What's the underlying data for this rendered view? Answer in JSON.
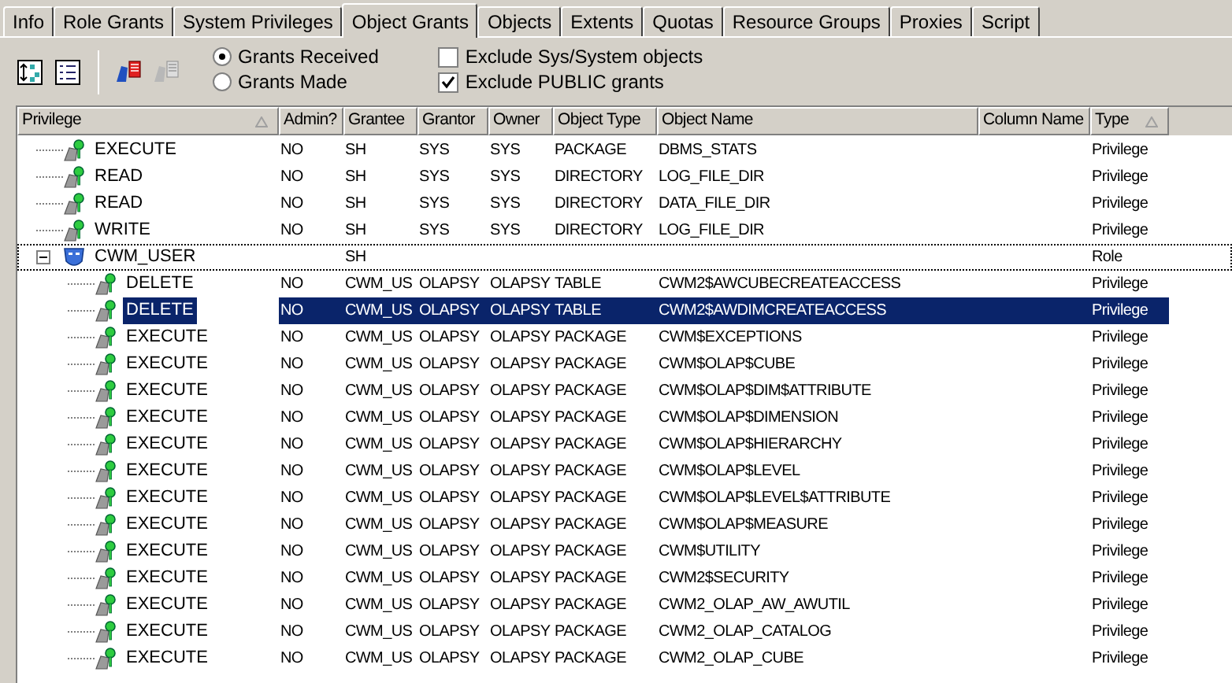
{
  "tabs": [
    {
      "label": "Info",
      "selected": false
    },
    {
      "label": "Role Grants",
      "selected": false
    },
    {
      "label": "System Privileges",
      "selected": false
    },
    {
      "label": "Object Grants",
      "selected": true
    },
    {
      "label": "Objects",
      "selected": false
    },
    {
      "label": "Extents",
      "selected": false
    },
    {
      "label": "Quotas",
      "selected": false
    },
    {
      "label": "Resource Groups",
      "selected": false
    },
    {
      "label": "Proxies",
      "selected": false
    },
    {
      "label": "Script",
      "selected": false
    }
  ],
  "toolbar": [
    {
      "kind": "tree",
      "disabled": false
    },
    {
      "kind": "list",
      "disabled": false
    },
    {
      "kind": "grant",
      "disabled": false
    },
    {
      "kind": "revoke",
      "disabled": true
    }
  ],
  "radios": [
    {
      "label": "Grants Received",
      "selected": true
    },
    {
      "label": "Grants Made",
      "selected": false
    }
  ],
  "checkboxes": [
    {
      "label": "Exclude Sys/System objects",
      "checked": false
    },
    {
      "label": "Exclude PUBLIC grants",
      "checked": true
    }
  ],
  "table": {
    "columns": [
      {
        "label": "Privilege",
        "sort": true
      },
      {
        "label": "Admin?",
        "sort": false
      },
      {
        "label": "Grantee",
        "sort": false
      },
      {
        "label": "Grantor",
        "sort": false
      },
      {
        "label": "Owner",
        "sort": false
      },
      {
        "label": "Object Type",
        "sort": false
      },
      {
        "label": "Object Name",
        "sort": false
      },
      {
        "label": "Column Name",
        "sort": false
      },
      {
        "label": "Type",
        "sort": true
      }
    ],
    "rows": [
      {
        "kind": "privilege",
        "selected": false,
        "cells": [
          "EXECUTE",
          "NO",
          "SH",
          "SYS",
          "SYS",
          "PACKAGE",
          "DBMS_STATS",
          "",
          "Privilege"
        ]
      },
      {
        "kind": "privilege",
        "selected": false,
        "cells": [
          "READ",
          "NO",
          "SH",
          "SYS",
          "SYS",
          "DIRECTORY",
          "LOG_FILE_DIR",
          "",
          "Privilege"
        ]
      },
      {
        "kind": "privilege",
        "selected": false,
        "cells": [
          "READ",
          "NO",
          "SH",
          "SYS",
          "SYS",
          "DIRECTORY",
          "DATA_FILE_DIR",
          "",
          "Privilege"
        ]
      },
      {
        "kind": "privilege",
        "selected": false,
        "cells": [
          "WRITE",
          "NO",
          "SH",
          "SYS",
          "SYS",
          "DIRECTORY",
          "LOG_FILE_DIR",
          "",
          "Privilege"
        ]
      },
      {
        "kind": "role",
        "selected": false,
        "expanded": true,
        "cells": [
          "CWM_USER",
          "",
          "SH",
          "",
          "",
          "",
          "",
          "",
          "Role"
        ],
        "children": [
          {
            "kind": "privilege",
            "selected": false,
            "cells": [
              "DELETE",
              "NO",
              "CWM_US",
              "OLAPSY",
              "OLAPSY",
              "TABLE",
              "CWM2$AWCUBECREATEACCESS",
              "",
              "Privilege"
            ]
          },
          {
            "kind": "privilege",
            "selected": true,
            "cells": [
              "DELETE",
              "NO",
              "CWM_US",
              "OLAPSY",
              "OLAPSY",
              "TABLE",
              "CWM2$AWDIMCREATEACCESS",
              "",
              "Privilege"
            ]
          },
          {
            "kind": "privilege",
            "selected": false,
            "cells": [
              "EXECUTE",
              "NO",
              "CWM_US",
              "OLAPSY",
              "OLAPSY",
              "PACKAGE",
              "CWM$EXCEPTIONS",
              "",
              "Privilege"
            ]
          },
          {
            "kind": "privilege",
            "selected": false,
            "cells": [
              "EXECUTE",
              "NO",
              "CWM_US",
              "OLAPSY",
              "OLAPSY",
              "PACKAGE",
              "CWM$OLAP$CUBE",
              "",
              "Privilege"
            ]
          },
          {
            "kind": "privilege",
            "selected": false,
            "cells": [
              "EXECUTE",
              "NO",
              "CWM_US",
              "OLAPSY",
              "OLAPSY",
              "PACKAGE",
              "CWM$OLAP$DIM$ATTRIBUTE",
              "",
              "Privilege"
            ]
          },
          {
            "kind": "privilege",
            "selected": false,
            "cells": [
              "EXECUTE",
              "NO",
              "CWM_US",
              "OLAPSY",
              "OLAPSY",
              "PACKAGE",
              "CWM$OLAP$DIMENSION",
              "",
              "Privilege"
            ]
          },
          {
            "kind": "privilege",
            "selected": false,
            "cells": [
              "EXECUTE",
              "NO",
              "CWM_US",
              "OLAPSY",
              "OLAPSY",
              "PACKAGE",
              "CWM$OLAP$HIERARCHY",
              "",
              "Privilege"
            ]
          },
          {
            "kind": "privilege",
            "selected": false,
            "cells": [
              "EXECUTE",
              "NO",
              "CWM_US",
              "OLAPSY",
              "OLAPSY",
              "PACKAGE",
              "CWM$OLAP$LEVEL",
              "",
              "Privilege"
            ]
          },
          {
            "kind": "privilege",
            "selected": false,
            "cells": [
              "EXECUTE",
              "NO",
              "CWM_US",
              "OLAPSY",
              "OLAPSY",
              "PACKAGE",
              "CWM$OLAP$LEVEL$ATTRIBUTE",
              "",
              "Privilege"
            ]
          },
          {
            "kind": "privilege",
            "selected": false,
            "cells": [
              "EXECUTE",
              "NO",
              "CWM_US",
              "OLAPSY",
              "OLAPSY",
              "PACKAGE",
              "CWM$OLAP$MEASURE",
              "",
              "Privilege"
            ]
          },
          {
            "kind": "privilege",
            "selected": false,
            "cells": [
              "EXECUTE",
              "NO",
              "CWM_US",
              "OLAPSY",
              "OLAPSY",
              "PACKAGE",
              "CWM$UTILITY",
              "",
              "Privilege"
            ]
          },
          {
            "kind": "privilege",
            "selected": false,
            "cells": [
              "EXECUTE",
              "NO",
              "CWM_US",
              "OLAPSY",
              "OLAPSY",
              "PACKAGE",
              "CWM2$SECURITY",
              "",
              "Privilege"
            ]
          },
          {
            "kind": "privilege",
            "selected": false,
            "cells": [
              "EXECUTE",
              "NO",
              "CWM_US",
              "OLAPSY",
              "OLAPSY",
              "PACKAGE",
              "CWM2_OLAP_AW_AWUTIL",
              "",
              "Privilege"
            ]
          },
          {
            "kind": "privilege",
            "selected": false,
            "cells": [
              "EXECUTE",
              "NO",
              "CWM_US",
              "OLAPSY",
              "OLAPSY",
              "PACKAGE",
              "CWM2_OLAP_CATALOG",
              "",
              "Privilege"
            ]
          },
          {
            "kind": "privilege",
            "selected": false,
            "cells": [
              "EXECUTE",
              "NO",
              "CWM_US",
              "OLAPSY",
              "OLAPSY",
              "PACKAGE",
              "CWM2_OLAP_CUBE",
              "",
              "Privilege"
            ]
          }
        ]
      }
    ]
  }
}
